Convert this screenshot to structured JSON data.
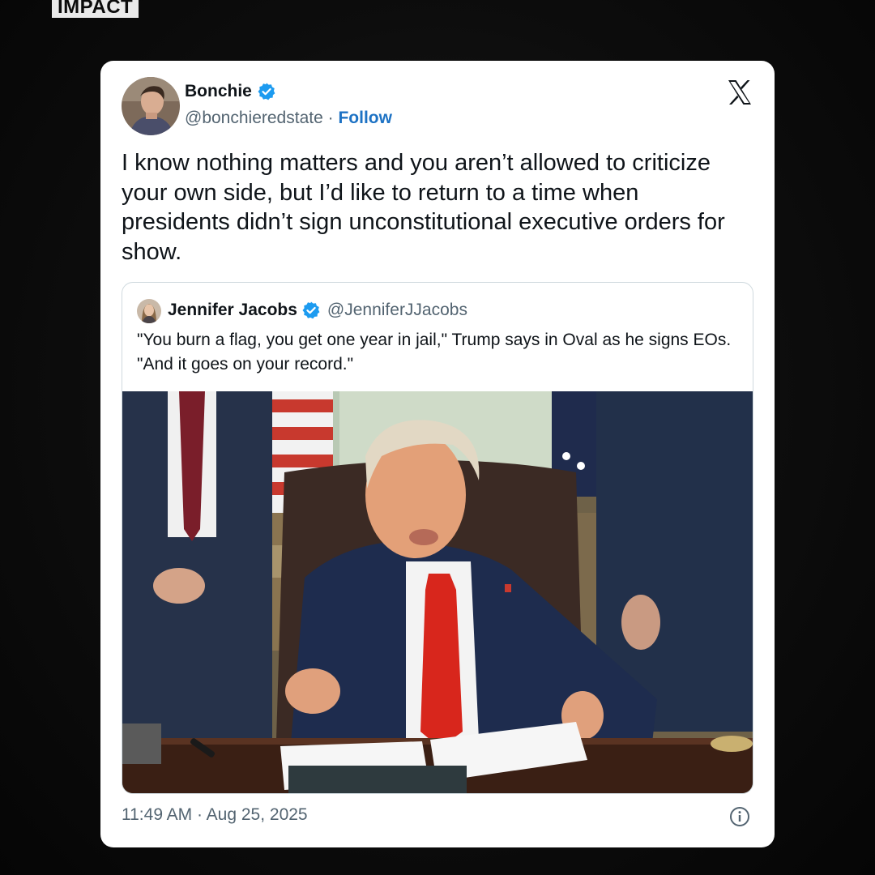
{
  "brand": {
    "label": "IMPACT"
  },
  "tweet": {
    "author": {
      "name": "Bonchie",
      "handle": "@bonchieredstate",
      "separator": "·",
      "follow_label": "Follow",
      "avatar_icon": "user-avatar"
    },
    "platform_icon": "x-logo-icon",
    "text": "I know nothing matters and you aren’t allowed to criticize your own side, but I’d like to return to a time when presidents didn’t sign unconstitutional executive orders for show.",
    "quoted": {
      "name": "Jennifer Jacobs",
      "handle": "@JenniferJJacobs",
      "text": "\"You burn a flag, you get one year in jail,\" Trump says in Oval as he signs EOs. \"And it goes on your record.\""
    },
    "timestamp": "11:49 AM · Aug 25, 2025",
    "info_icon": "info-icon"
  },
  "colors": {
    "background": "#0b0b0b",
    "card": "#ffffff",
    "text_primary": "#0f1419",
    "text_secondary": "#536471",
    "link": "#1d72c4",
    "verified": "#1d9bf0"
  }
}
